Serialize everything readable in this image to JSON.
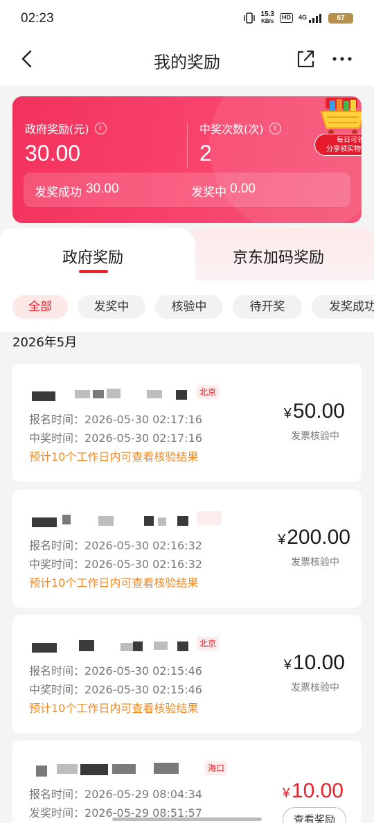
{
  "status_bar": {
    "time": "02:23",
    "net_speed_value": "15.3",
    "net_speed_unit": "KB/s",
    "hd_badge": "HD",
    "network": "4G",
    "battery": "67"
  },
  "nav": {
    "title": "我的奖励",
    "back_icon": "chevron-left-icon",
    "share_icon": "share-icon",
    "more_icon": "more-dots-icon"
  },
  "summary": {
    "gov_label": "政府奖励(元)",
    "gov_value": "30.00",
    "count_label": "中奖次数(次)",
    "count_value": "2",
    "issued_label": "发奖成功",
    "issued_value": "30.00",
    "pending_label": "发奖中",
    "pending_value": "0.00",
    "promo_line1": "每日可领",
    "promo_line2": "分享领实物好礼",
    "colors": {
      "card_start": "#f2325c",
      "card_end": "#f65577",
      "accent": "#e8202a"
    }
  },
  "tabs": [
    {
      "label": "政府奖励",
      "active": true
    },
    {
      "label": "京东加码奖励",
      "active": false
    }
  ],
  "filters": [
    "全部",
    "发奖中",
    "核验中",
    "待开奖",
    "发奖成功"
  ],
  "active_filter": "全部",
  "month": "2026年5月",
  "orders": [
    {
      "city": "北京",
      "reg_label": "报名时间：",
      "reg_time": "2026-05-30 02:17:16",
      "second_label": "中奖时间：",
      "second_time": "2026-05-30 02:17:16",
      "tip": "预计10个工作日内可查看核验结果",
      "yen": "¥",
      "amount": "50.00",
      "status": "发票核验中"
    },
    {
      "city": "",
      "reg_label": "报名时间：",
      "reg_time": "2026-05-30 02:16:32",
      "second_label": "中奖时间：",
      "second_time": "2026-05-30 02:16:32",
      "tip": "预计10个工作日内可查看核验结果",
      "yen": "¥",
      "amount": "200.00",
      "status": "发票核验中"
    },
    {
      "city": "北京",
      "reg_label": "报名时间：",
      "reg_time": "2026-05-30 02:15:46",
      "second_label": "中奖时间：",
      "second_time": "2026-05-30 02:15:46",
      "tip": "预计10个工作日内可查看核验结果",
      "yen": "¥",
      "amount": "10.00",
      "status": "发票核验中"
    },
    {
      "city": "海口",
      "reg_label": "报名时间：",
      "reg_time": "2026-05-29 08:04:34",
      "second_label": "发奖时间：",
      "second_time": "2026-05-29 08:51:57",
      "yen": "¥",
      "amount": "10.00",
      "button": "查看奖励"
    }
  ]
}
